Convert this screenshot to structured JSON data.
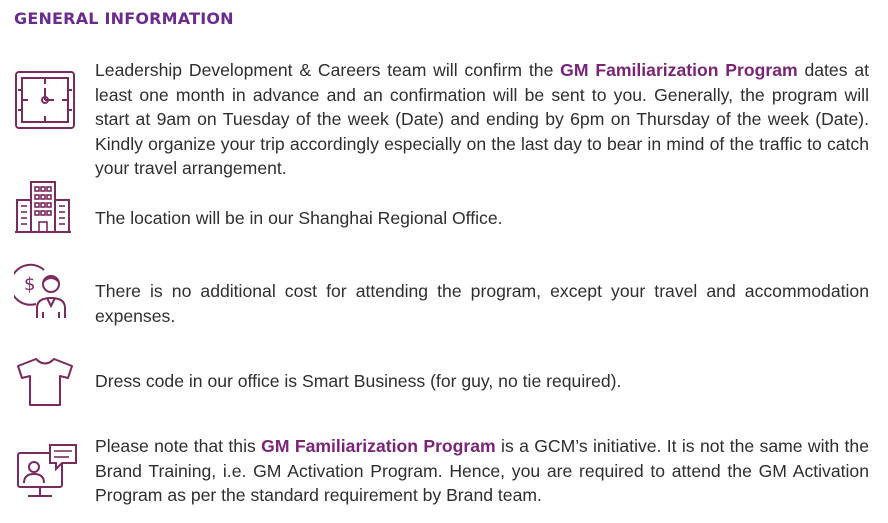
{
  "heading": "GENERAL INFORMATION",
  "colors": {
    "accent": "#7b2377",
    "heading": "#6a2c8e",
    "icon": "#7a2a5e",
    "text": "#2e2e2e"
  },
  "items": [
    {
      "icon": "clock-calendar-icon",
      "p1": "Leadership Development & Careers team will confirm the ",
      "highlight": "GM Familiarization Program",
      "p2": " dates at least one month in advance and an confirmation will be sent to you. Generally, the program will start at 9am on Tuesday of the week (Date) and ending by 6pm on Thursday of the week (Date).  Kindly organize your trip accordingly especially on the last day to bear in mind of the traffic to catch your travel arrangement."
    },
    {
      "icon": "office-building-icon",
      "text": "The location will be in our Shanghai Regional Office."
    },
    {
      "icon": "person-cost-icon",
      "text": "There is no additional cost for attending the program, except your travel and accommodation expenses."
    },
    {
      "icon": "tshirt-icon",
      "text": "Dress code in our office is Smart Business (for guy, no tie required)."
    },
    {
      "icon": "video-training-icon",
      "p1": "Please note that this ",
      "highlight": "GM Familiarization Program",
      "p2": " is a GCM’s initiative.  It is not the same with the Brand Training, i.e. GM Activation Program.  Hence, you are required to attend the GM Activation Program as per the standard requirement by Brand team."
    }
  ]
}
